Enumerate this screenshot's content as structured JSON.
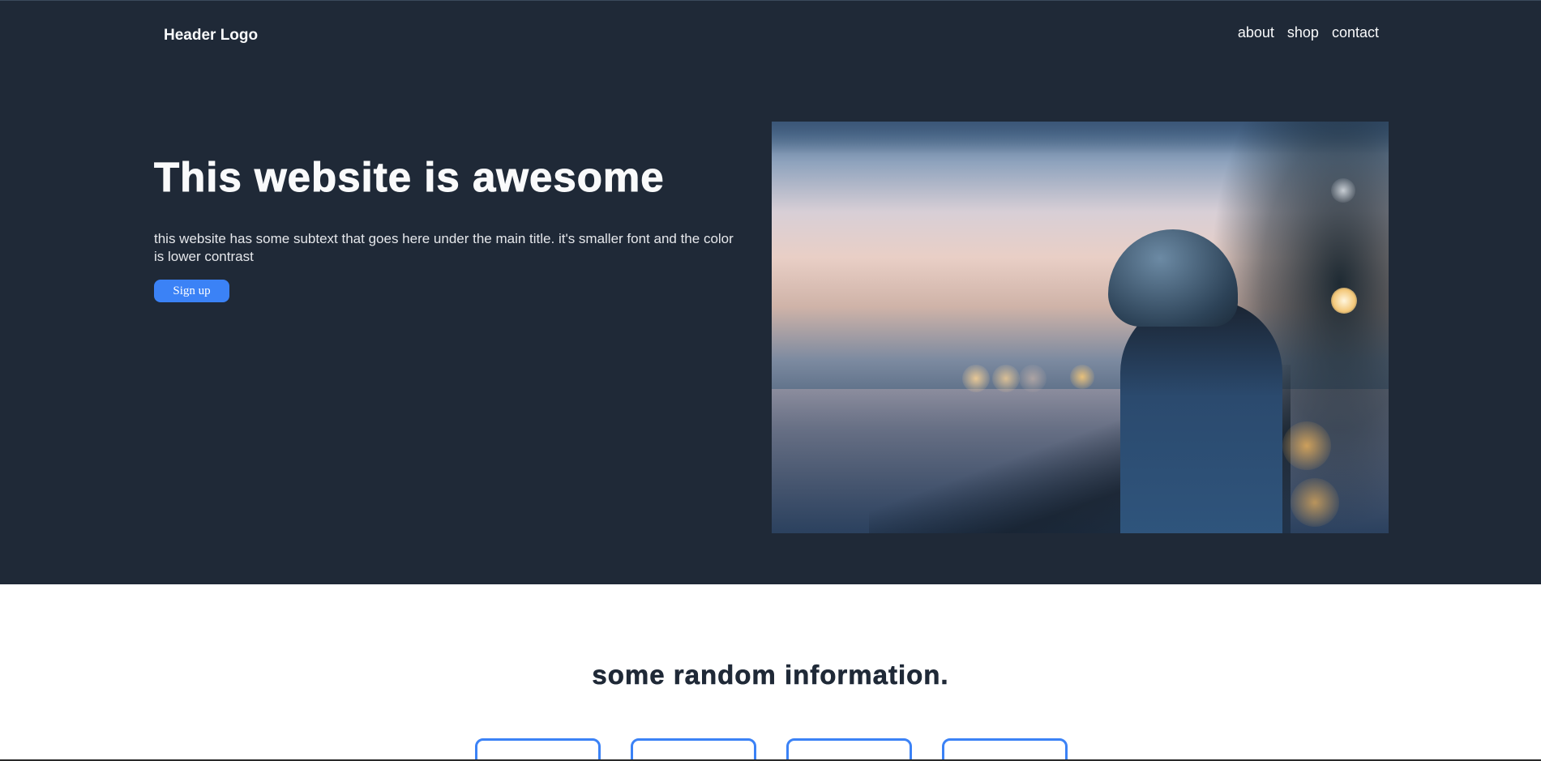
{
  "header": {
    "logo": "Header Logo",
    "nav": [
      "about",
      "shop",
      "contact"
    ]
  },
  "hero": {
    "title": "This website is awesome",
    "subtitle": "this website has some subtext that goes here under the main title. it's smaller font and the color is lower contrast",
    "button_label": "Sign up"
  },
  "info": {
    "title": "some random information.",
    "card_count": 4
  },
  "colors": {
    "hero_bg": "#1f2937",
    "accent": "#3b82f6",
    "text_light": "#f9fafb"
  }
}
